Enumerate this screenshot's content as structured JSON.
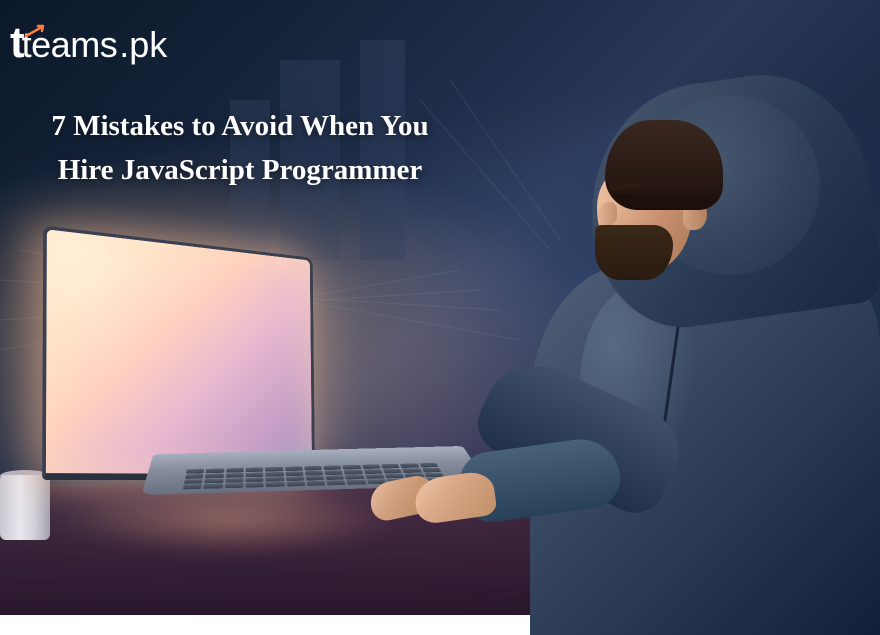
{
  "logo": {
    "text_main": "teams",
    "text_suffix": ".pk"
  },
  "headline": "7 Mistakes to Avoid When You Hire JavaScript Programmer",
  "colors": {
    "logo_accent": "#ff7a3d",
    "text": "#ffffff"
  }
}
